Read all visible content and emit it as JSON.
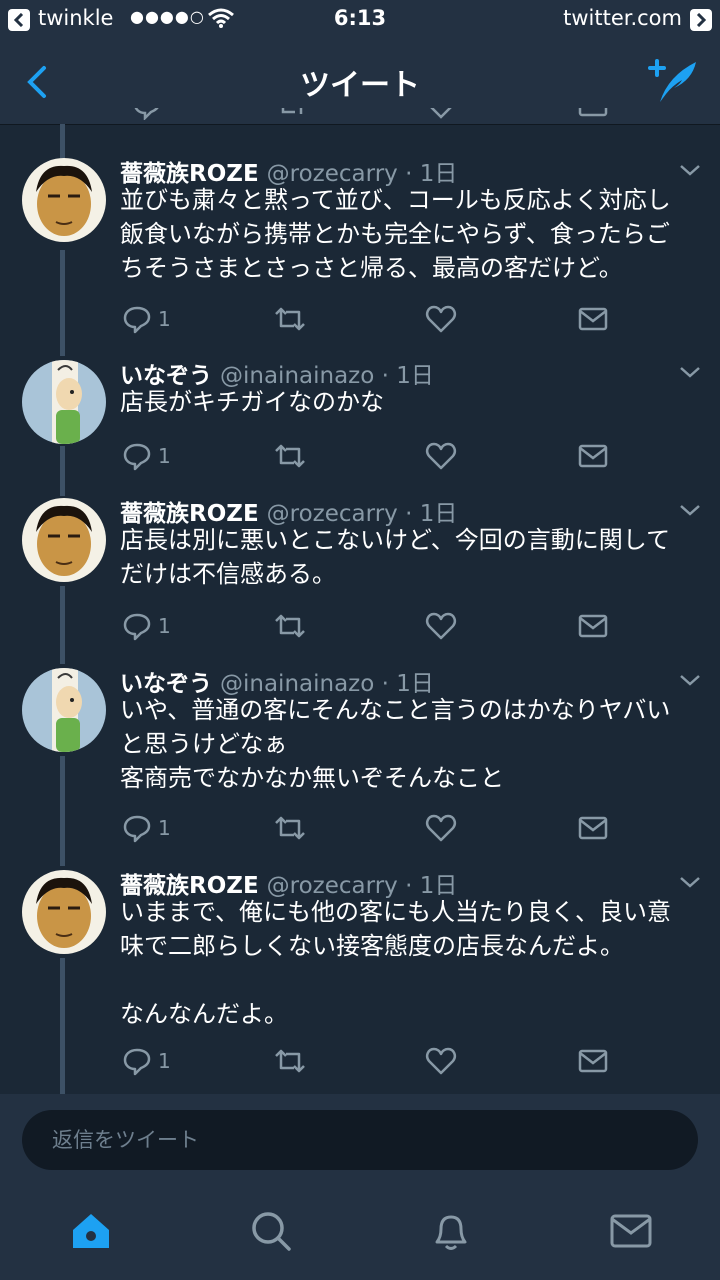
{
  "status_bar": {
    "app": "twinkle",
    "signal_dots": "●●●●○",
    "time": "6:13",
    "site": "twitter.com"
  },
  "nav": {
    "title": "ツイート"
  },
  "tweets": [
    {
      "name": "薔薇族ROZE",
      "handle": "@rozecarry · 1日",
      "text": "並びも粛々と黙って並び、コールも反応よく対応し\n飯食いながら携帯とかも完全にやらず、食ったらご\nちそうさまとさっさと帰る、最高の客だけど。",
      "reply_count": "1"
    },
    {
      "name": "いなぞう",
      "handle": "@inainainazo · 1日",
      "text": "店長がキチガイなのかな",
      "reply_count": "1"
    },
    {
      "name": "薔薇族ROZE",
      "handle": "@rozecarry · 1日",
      "text": "店長は別に悪いとこないけど、今回の言動に関して\nだけは不信感ある。",
      "reply_count": "1"
    },
    {
      "name": "いなぞう",
      "handle": "@inainainazo · 1日",
      "text": "いや、普通の客にそんなこと言うのはかなりヤバい\nと思うけどなぁ\n客商売でなかなか無いぞそんなこと",
      "reply_count": "1"
    },
    {
      "name": "薔薇族ROZE",
      "handle": "@rozecarry · 1日",
      "text": "いままで、俺にも他の客にも人当たり良く、良い意\n味で二郎らしくない接客態度の店長なんだよ。\n\nなんなんだよ。",
      "reply_count": "1"
    }
  ],
  "reply_bar": {
    "placeholder": "返信をツイート"
  },
  "icons": {
    "back": "chevron-left-icon",
    "compose": "compose-tweet-icon",
    "reply": "reply-icon",
    "retweet": "retweet-icon",
    "like": "heart-icon",
    "dm": "envelope-icon",
    "home": "home-icon",
    "search": "search-icon",
    "notifications": "bell-icon",
    "messages": "envelope-icon"
  },
  "colors": {
    "background": "#1b2836",
    "bar": "#233142",
    "accent": "#1da1f2",
    "muted": "#8899a6"
  }
}
